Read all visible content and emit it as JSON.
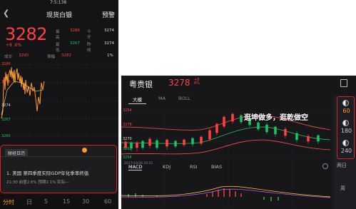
{
  "left": {
    "status_time": "7:5:138",
    "title": "现货白银",
    "warn_label": "预警",
    "price": "3282",
    "change": "+8 .6%",
    "quote_rows": [
      {
        "l1": "最高",
        "v1": "3286",
        "l2": "今开",
        "v2": "3274"
      },
      {
        "l1": "最低",
        "v1": "3267",
        "l2": "昨收",
        "v2": "3274"
      }
    ],
    "volume_label": "成交",
    "volume_value": "3290",
    "amp_label": "振幅",
    "amp_value": "3282",
    "amp_pct": "1%",
    "chart_ticks": [
      "3286",
      "3278",
      "3274",
      "3267",
      "3260"
    ],
    "calendar": {
      "title": "财经日历",
      "item": "1. 美国 第四季度实际GDP年化季率终值",
      "meta": "21:30 前值2.6% 预期2.1% 实际---"
    },
    "periods": [
      "分时",
      "日",
      "5",
      "15",
      "30",
      "60"
    ]
  },
  "right": {
    "title": "粤贵银",
    "price": "3278",
    "change_top": "+8",
    "change_bottom": "6%",
    "main_tabs": [
      "大模",
      "MA",
      "BOLL"
    ],
    "indicator_tabs": [
      "MACD",
      "KDJ",
      "RSI",
      "BIAS"
    ],
    "annotation": "逛坤做多，逛乾做空",
    "period_labels": [
      "60",
      "180",
      "240"
    ],
    "side_labels": [
      "两日",
      "周"
    ],
    "y_ticks": [
      "3254",
      "3278",
      "3270",
      "3262",
      "3254"
    ],
    "date_label": "2017/10/30 10:31"
  },
  "colors": {
    "up": "#ff4040",
    "down": "#20c060",
    "highlight": "#d42020",
    "orange": "#ff9a30"
  }
}
